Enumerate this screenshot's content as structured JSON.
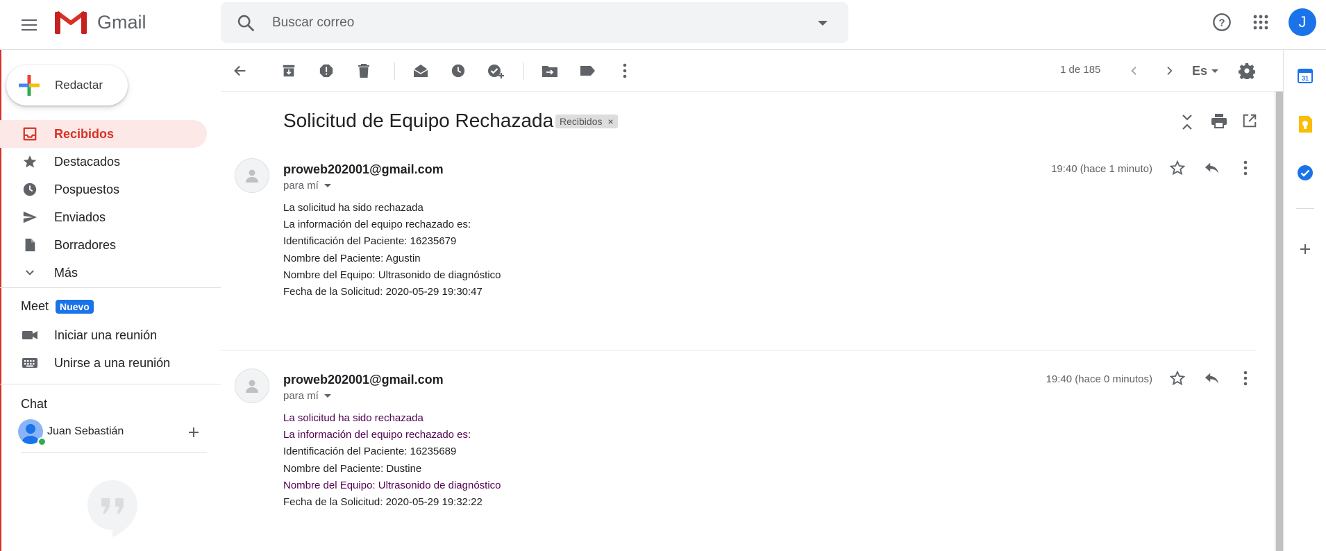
{
  "app": {
    "name": "Gmail"
  },
  "search": {
    "placeholder": "Buscar correo"
  },
  "header": {
    "avatar_letter": "J"
  },
  "compose": {
    "label": "Redactar"
  },
  "nav": {
    "items": [
      {
        "label": "Recibidos",
        "icon": "inbox-icon",
        "active": true
      },
      {
        "label": "Destacados",
        "icon": "star-icon"
      },
      {
        "label": "Pospuestos",
        "icon": "clock-icon"
      },
      {
        "label": "Enviados",
        "icon": "send-icon"
      },
      {
        "label": "Borradores",
        "icon": "draft-icon"
      },
      {
        "label": "Más",
        "icon": "chevron-down-icon"
      }
    ]
  },
  "meet": {
    "title": "Meet",
    "badge": "Nuevo",
    "items": [
      {
        "label": "Iniciar una reunión",
        "icon": "video-icon"
      },
      {
        "label": "Unirse a una reunión",
        "icon": "keyboard-icon"
      }
    ]
  },
  "chat": {
    "title": "Chat",
    "user": "Juan Sebastián"
  },
  "toolbar": {
    "pager": "1 de 185",
    "language": "Es"
  },
  "thread": {
    "subject": "Solicitud de Equipo Rechazada",
    "label": "Recibidos",
    "messages": [
      {
        "sender": "proweb202001@gmail.com",
        "to": "para mí",
        "time": "19:40 (hace 1 minuto)",
        "lines": [
          "La solicitud ha sido rechazada",
          "La información del equipo rechazado es:",
          "Identificación del Paciente: 16235679",
          "Nombre del Paciente: Agustin",
          "Nombre del Equipo: Ultrasonido de diagnóstico",
          "Fecha de la Solicitud: 2020-05-29 19:30:47"
        ]
      },
      {
        "sender": "proweb202001@gmail.com",
        "to": "para mí",
        "time": "19:40 (hace 0 minutos)",
        "lines": [
          "La solicitud ha sido rechazada",
          "La información del equipo rechazado es:",
          "Identificación del Paciente: 16235689",
          "Nombre del Paciente: Dustine",
          "Nombre del Equipo: Ultrasonido de diagnóstico",
          "Fecha de la Solicitud: 2020-05-29 19:32:22"
        ]
      }
    ]
  },
  "colors": {
    "accent_red": "#d93025",
    "active_bg": "#fce8e6",
    "blue": "#1a73e8",
    "quoted_purple": "#500050"
  }
}
